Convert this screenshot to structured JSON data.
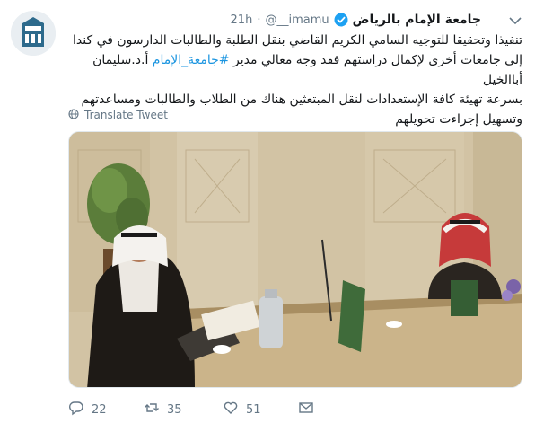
{
  "tweet": {
    "display_name": "جامعة الإمام بالرياض",
    "handle": "@__imamu",
    "separator": "·",
    "time": "21h",
    "text_lines": [
      "تنفيذا وتحقيقا للتوجيه السامي الكريم القاضي بنقل الطلبة والطالبات الدارسون في كندا",
      "إلى جامعات أخرى لإكمال دراستهم فقد وجه معالي مدير",
      "أ.د.سليمان أباالخيل",
      "بسرعة تهيئة  كافة الإستعدادات لنقل المبتعثين هناك من الطلاب والطالبات ومساعدتهم",
      "وتسهيل إجراءت تحويلهم"
    ],
    "hashtag": "#جامعة_الإمام",
    "translate_label": "Translate Tweet",
    "actions": {
      "replies": "22",
      "retweets": "35",
      "likes": "51"
    },
    "icons": {
      "avatar": "university-logo-icon",
      "verified": "verified-badge-icon",
      "caret": "chevron-down-icon",
      "translate": "globe-icon",
      "reply": "reply-icon",
      "retweet": "retweet-icon",
      "like": "heart-icon",
      "message": "direct-message-icon"
    },
    "colors": {
      "link": "#1b95e0",
      "muted": "#657786",
      "verified": "#1da1f2"
    }
  }
}
